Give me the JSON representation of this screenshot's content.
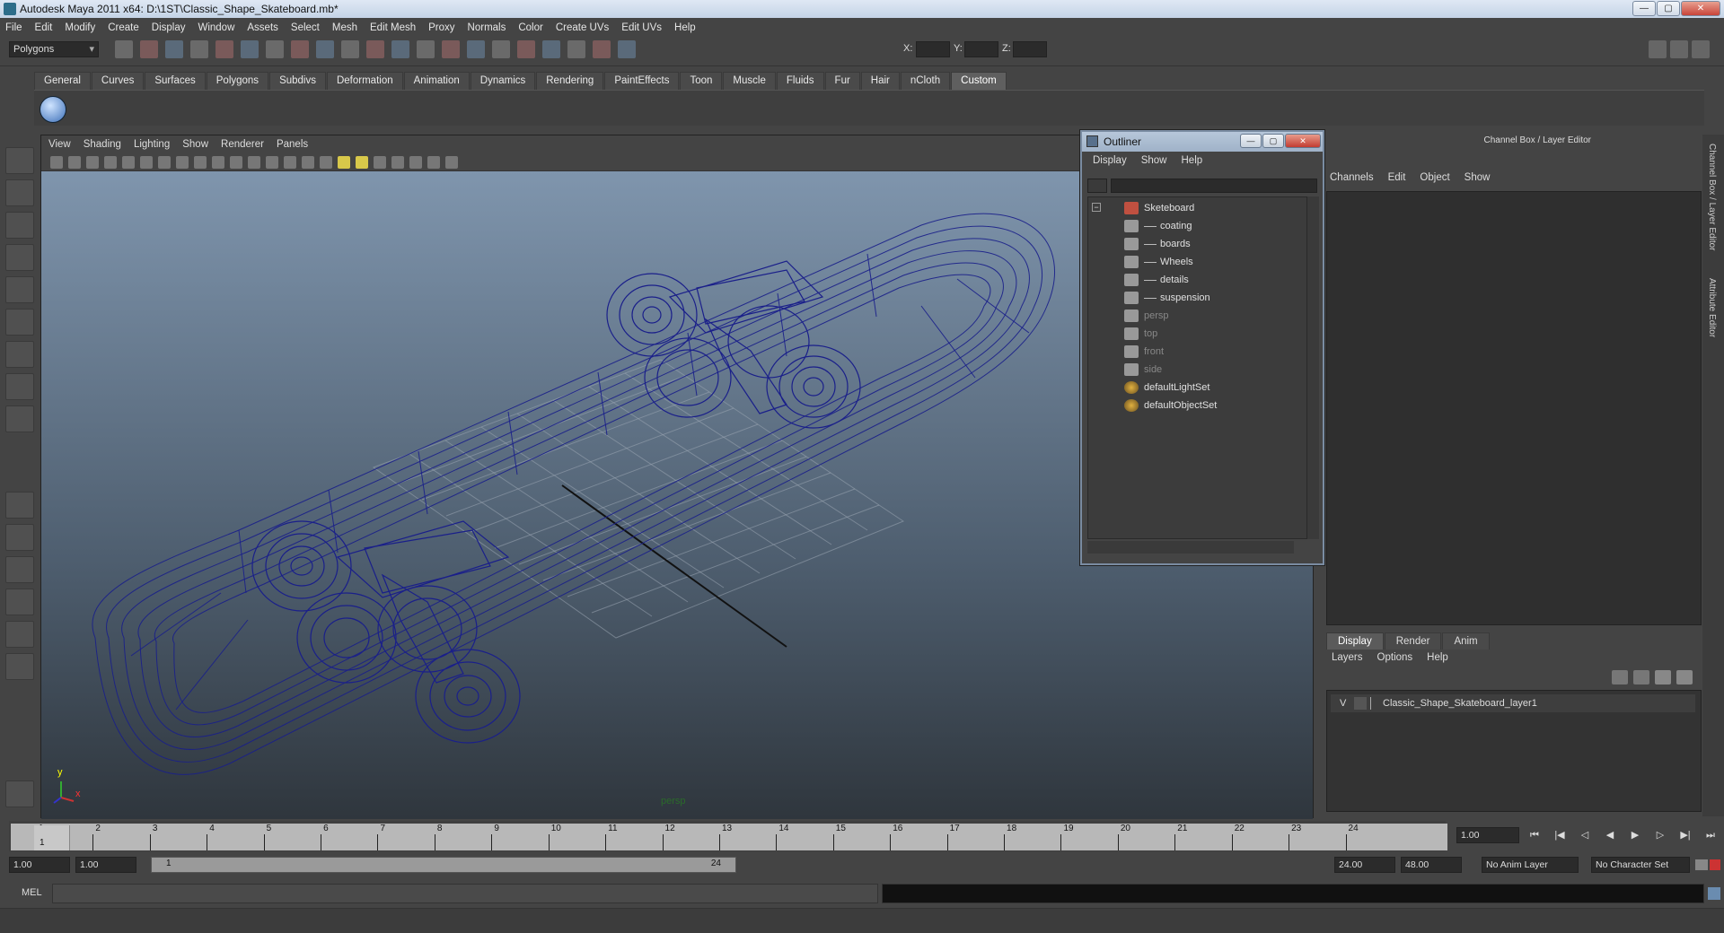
{
  "window": {
    "title": "Autodesk Maya 2011 x64: D:\\1ST\\Classic_Shape_Skateboard.mb*"
  },
  "menubar": [
    "File",
    "Edit",
    "Modify",
    "Create",
    "Display",
    "Window",
    "Assets",
    "Select",
    "Mesh",
    "Edit Mesh",
    "Proxy",
    "Normals",
    "Color",
    "Create UVs",
    "Edit UVs",
    "Help"
  ],
  "statusline": {
    "mode": "Polygons",
    "x_label": "X:",
    "y_label": "Y:",
    "z_label": "Z:"
  },
  "shelf_tabs": [
    "General",
    "Curves",
    "Surfaces",
    "Polygons",
    "Subdivs",
    "Deformation",
    "Animation",
    "Dynamics",
    "Rendering",
    "PaintEffects",
    "Toon",
    "Muscle",
    "Fluids",
    "Fur",
    "Hair",
    "nCloth",
    "Custom"
  ],
  "shelf_active": "Custom",
  "viewport": {
    "menu": [
      "View",
      "Shading",
      "Lighting",
      "Show",
      "Renderer",
      "Panels"
    ],
    "camera_label": "persp",
    "axis_y": "y",
    "axis_x": "x"
  },
  "outliner": {
    "title": "Outliner",
    "menu": [
      "Display",
      "Show",
      "Help"
    ],
    "items": [
      {
        "label": "Sketeboard",
        "level": 0,
        "dim": false,
        "icon": "group-icon"
      },
      {
        "label": "coating",
        "level": 1,
        "dim": false,
        "icon": "mesh-icon"
      },
      {
        "label": "boards",
        "level": 1,
        "dim": false,
        "icon": "mesh-icon"
      },
      {
        "label": "Wheels",
        "level": 1,
        "dim": false,
        "icon": "mesh-icon"
      },
      {
        "label": "details",
        "level": 1,
        "dim": false,
        "icon": "mesh-icon"
      },
      {
        "label": "suspension",
        "level": 1,
        "dim": false,
        "icon": "mesh-icon"
      },
      {
        "label": "persp",
        "level": 0,
        "dim": true,
        "icon": "camera-icon"
      },
      {
        "label": "top",
        "level": 0,
        "dim": true,
        "icon": "camera-icon"
      },
      {
        "label": "front",
        "level": 0,
        "dim": true,
        "icon": "camera-icon"
      },
      {
        "label": "side",
        "level": 0,
        "dim": true,
        "icon": "camera-icon"
      },
      {
        "label": "defaultLightSet",
        "level": 0,
        "dim": false,
        "icon": "set-icon"
      },
      {
        "label": "defaultObjectSet",
        "level": 0,
        "dim": false,
        "icon": "set-icon"
      }
    ]
  },
  "channelbox": {
    "header": "Channel Box / Layer Editor",
    "menu": [
      "Channels",
      "Edit",
      "Object",
      "Show"
    ],
    "layer_tabs": [
      "Display",
      "Render",
      "Anim"
    ],
    "layer_active": "Display",
    "layer_menu": [
      "Layers",
      "Options",
      "Help"
    ],
    "layer": {
      "visibility": "V",
      "name": "Classic_Shape_Skateboard_layer1"
    }
  },
  "side_tabs": [
    "Channel Box / Layer Editor",
    "Attribute Editor"
  ],
  "timeline": {
    "ticks": [
      "1",
      "2",
      "3",
      "4",
      "5",
      "6",
      "7",
      "8",
      "9",
      "10",
      "11",
      "12",
      "13",
      "14",
      "15",
      "16",
      "17",
      "18",
      "19",
      "20",
      "21",
      "22",
      "23",
      "24"
    ],
    "current_frame_marker": "1",
    "current_time": "1.00"
  },
  "range": {
    "start": "1.00",
    "playback_start": "1.00",
    "bar_start": "1",
    "bar_end": "24",
    "playback_end": "24.00",
    "end": "48.00",
    "anim_layer": "No Anim Layer",
    "character_set": "No Character Set"
  },
  "mel": {
    "label": "MEL"
  },
  "colors": {
    "wireframe": "#1a1f8a",
    "bg_top": "#7f95ad",
    "bg_bottom": "#2f363d",
    "ui": "#444444"
  }
}
